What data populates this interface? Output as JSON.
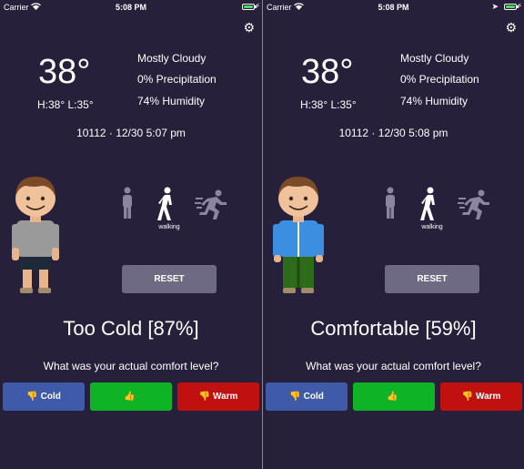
{
  "screens": [
    {
      "status": {
        "carrier": "Carrier",
        "time": "5:08 PM"
      },
      "weather": {
        "temperature": "38°",
        "hilo": "H:38° L:35°",
        "condition": "Mostly Cloudy",
        "precipitation": "0% Precipitation",
        "humidity": "74% Humidity",
        "location_time": "10112  ·  12/30 5:07 pm"
      },
      "activity": {
        "selected": "walking",
        "label": "walking"
      },
      "reset_label": "RESET",
      "result": "Too Cold [87%]",
      "question": "What was your actual comfort level?",
      "buttons": {
        "cold": "Cold",
        "ok": "",
        "warm": "Warm"
      },
      "avatar": {
        "shirt_color": "#9a9a9a",
        "pants_color": "#1e2a3a",
        "type": "t-shirt-shorts"
      }
    },
    {
      "status": {
        "carrier": "Carrier",
        "time": "5:08 PM"
      },
      "weather": {
        "temperature": "38°",
        "hilo": "H:38° L:35°",
        "condition": "Mostly Cloudy",
        "precipitation": "0% Precipitation",
        "humidity": "74% Humidity",
        "location_time": "10112  ·  12/30 5:08 pm"
      },
      "activity": {
        "selected": "walking",
        "label": "walking"
      },
      "reset_label": "RESET",
      "result": "Comfortable [59%]",
      "question": "What was your actual comfort level?",
      "buttons": {
        "cold": "Cold",
        "ok": "",
        "warm": "Warm"
      },
      "avatar": {
        "shirt_color": "#3c8fe0",
        "pants_color": "#2d6a1a",
        "type": "jacket-pants"
      }
    }
  ],
  "colors": {
    "background": "#27203a",
    "cold": "#3f5aa8",
    "ok": "#0fb326",
    "warm": "#c01010",
    "reset": "#6f6a84",
    "battery": "#4cd964"
  },
  "icons": {
    "settings": "gear-icon",
    "standing": "standing-person-icon",
    "walking": "walking-person-icon",
    "running": "running-person-icon",
    "thumbs_down": "thumbs-down-icon",
    "thumbs_up": "thumbs-up-icon"
  }
}
